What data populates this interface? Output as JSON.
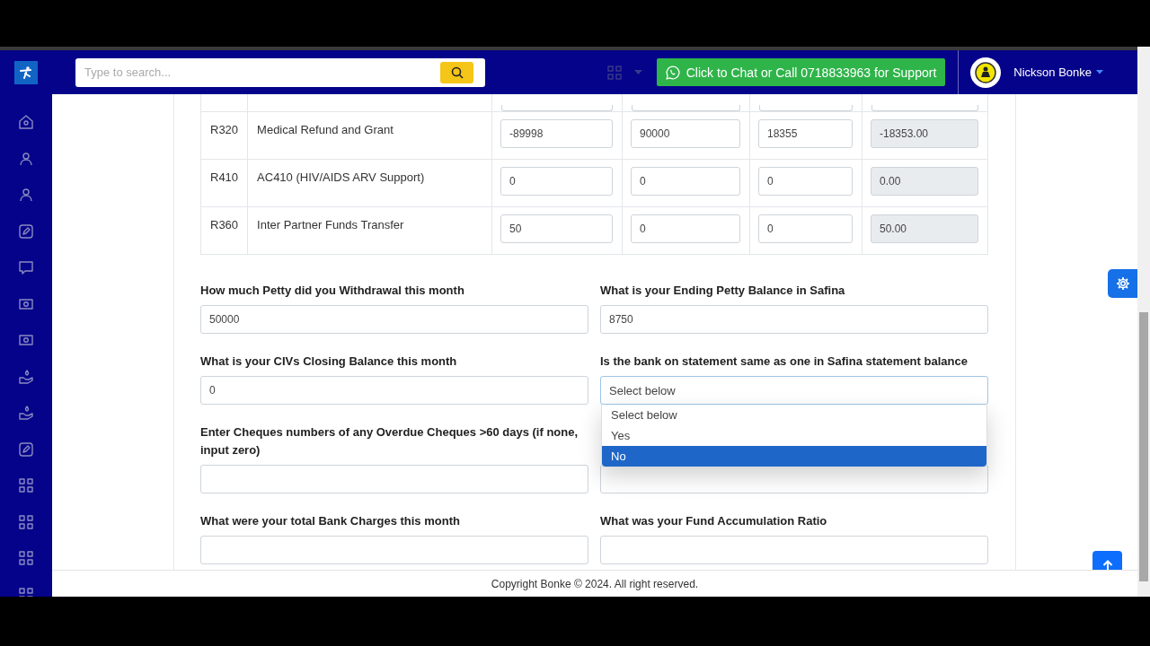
{
  "header": {
    "search": {
      "placeholder": "Type to search..."
    },
    "support_button": "Click to Chat or Call 0718833963 for Support",
    "user": {
      "name": "Nickson Bonke"
    }
  },
  "sidebar": {
    "items": [
      {
        "kind": "home"
      },
      {
        "kind": "user"
      },
      {
        "kind": "user"
      },
      {
        "kind": "edit"
      },
      {
        "kind": "chat"
      },
      {
        "kind": "money"
      },
      {
        "kind": "money"
      },
      {
        "kind": "donate"
      },
      {
        "kind": "donate"
      },
      {
        "kind": "edit"
      },
      {
        "kind": "grid"
      },
      {
        "kind": "grid"
      },
      {
        "kind": "grid"
      },
      {
        "kind": "grid"
      }
    ]
  },
  "table": {
    "rows": [
      {
        "code": "R320",
        "name": "Medical Refund and Grant",
        "values": [
          "-89998",
          "90000",
          "18355"
        ],
        "total": "-18353.00"
      },
      {
        "code": "R410",
        "name": "AC410 (HIV/AIDS ARV Support)",
        "values": [
          "0",
          "0",
          "0"
        ],
        "total": "0.00"
      },
      {
        "code": "R360",
        "name": "Inter Partner Funds Transfer",
        "values": [
          "50",
          "0",
          "0"
        ],
        "total": "50.00"
      }
    ]
  },
  "form": {
    "rows": [
      {
        "fields": [
          {
            "kind": "input",
            "label": "How much Petty did you Withdrawal this month",
            "value": "50000"
          },
          {
            "kind": "input",
            "label": "What is your Ending Petty Balance in Safina",
            "value": "8750"
          }
        ]
      },
      {
        "fields": [
          {
            "kind": "input",
            "label": "What is your CIVs Closing Balance this month",
            "value": "0"
          },
          {
            "kind": "select",
            "label": "Is the bank on statement same as one in Safina statement balance",
            "value": "Select below",
            "options": [
              {
                "label": "Select below",
                "highlighted": false
              },
              {
                "label": "Yes",
                "highlighted": false
              },
              {
                "label": "No",
                "highlighted": true
              }
            ]
          }
        ]
      },
      {
        "fields": [
          {
            "kind": "input",
            "label": "Enter Cheques numbers of any Overdue Cheques >60 days (if none, input zero)"
          },
          {
            "kind": "input"
          }
        ]
      },
      {
        "fields": [
          {
            "kind": "input",
            "label": "What were your total Bank Charges this month"
          },
          {
            "kind": "input",
            "label": "What was your Fund Accumulation Ratio"
          }
        ]
      }
    ]
  },
  "footer": "Copyright Bonke © 2024. All right reserved."
}
